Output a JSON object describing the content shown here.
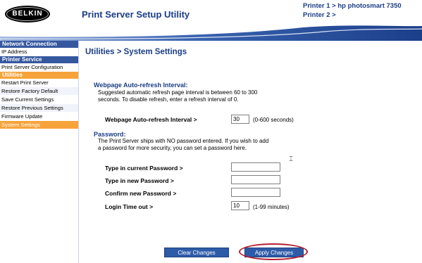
{
  "header": {
    "logo_text": "BELKIN",
    "app_title": "Print Server Setup Utility",
    "printers": [
      "Printer 1 > hp photosmart 7350",
      "Printer 2 >"
    ]
  },
  "sidebar": {
    "sections": [
      {
        "title": "Network Connection",
        "items": [
          "IP Address"
        ]
      },
      {
        "title": "Printer Service",
        "items": [
          "Print Server Configuration"
        ]
      },
      {
        "title": "Utilities",
        "items": [
          "Restart Print Server",
          "Restore Factory Default",
          "Save Current Settings",
          "Restore Previous Settings",
          "Firmware Update",
          "System Settings"
        ]
      }
    ],
    "active_item": "System Settings"
  },
  "main": {
    "title": "Utilities > System Settings",
    "refresh": {
      "heading": "Webpage Auto-refresh Interval:",
      "desc_line1": "Suggested automatic refresh page interval is between 60 to 300",
      "desc_line2": "seconds. To disable refresh, enter a refresh interval of 0.",
      "label": "Webpage Auto-refresh Interval >",
      "value": "30",
      "hint": "(0-600 seconds)"
    },
    "password": {
      "heading": "Password:",
      "desc_line1": "The Print Server ships with NO password entered. If you wish to add",
      "desc_line2": "a password for more security, you can set a password here.",
      "current_label": "Type in current Password >",
      "current_value": "",
      "new_label": "Type in new Password >",
      "new_value": "",
      "confirm_label": "Confirm new Password >",
      "confirm_value": "",
      "timeout_label": "Login Time out >",
      "timeout_value": "10",
      "timeout_hint": "(1-99 minutes)"
    },
    "buttons": {
      "clear": "Clear Changes",
      "apply": "Apply Changes"
    }
  },
  "colors": {
    "accent_blue": "#35579e",
    "accent_orange": "#f6a33b",
    "title_blue": "#1a3d86",
    "highlight_ring": "#b32030"
  },
  "icons": [
    "cursor-icon"
  ]
}
